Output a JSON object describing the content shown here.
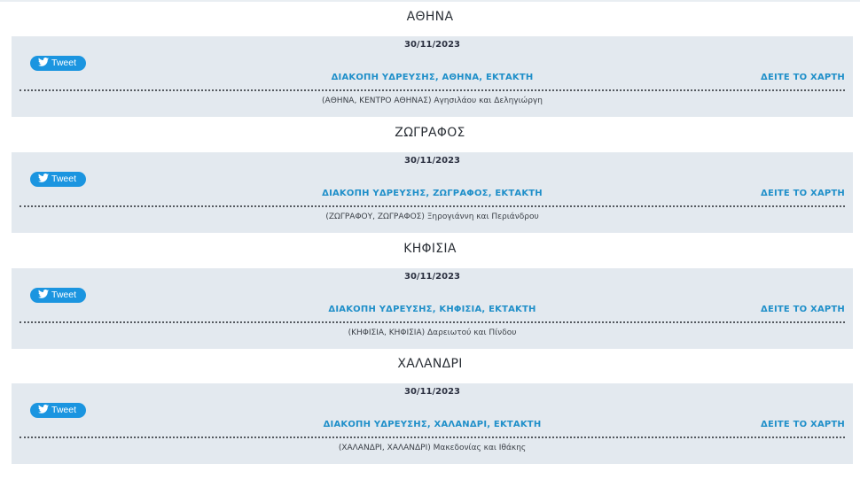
{
  "sections": [
    {
      "area": "ΑΘΗΝΑ",
      "date": "30/11/2023",
      "tweet_label": "Tweet",
      "incident": "ΔΙΑΚΟΠΗ ΥΔΡΕΥΣΗΣ, ΑΘΗΝΑ, ΕΚΤΑΚΤΗ",
      "map_link": "ΔΕΙΤΕ ΤΟ ΧΑΡΤΗ",
      "address": "(ΑΘΗΝΑ, ΚΕΝΤΡΟ ΑΘΗΝΑΣ) Αγησιλάου και Δεληγιώργη"
    },
    {
      "area": "ΖΩΓΡΑΦΟΣ",
      "date": "30/11/2023",
      "tweet_label": "Tweet",
      "incident": "ΔΙΑΚΟΠΗ ΥΔΡΕΥΣΗΣ, ΖΩΓΡΑΦΟΣ, ΕΚΤΑΚΤΗ",
      "map_link": "ΔΕΙΤΕ ΤΟ ΧΑΡΤΗ",
      "address": "(ΖΩΓΡΑΦΟΥ, ΖΩΓΡΑΦΟΣ) Ξηρογιάννη και Περιάνδρου"
    },
    {
      "area": "ΚΗΦΙΣΙΑ",
      "date": "30/11/2023",
      "tweet_label": "Tweet",
      "incident": "ΔΙΑΚΟΠΗ ΥΔΡΕΥΣΗΣ, ΚΗΦΙΣΙΑ, ΕΚΤΑΚΤΗ",
      "map_link": "ΔΕΙΤΕ ΤΟ ΧΑΡΤΗ",
      "address": "(ΚΗΦΙΣΙΑ, ΚΗΦΙΣΙΑ) Δαρειωτού και Πίνδου"
    },
    {
      "area": "ΧΑΛΑΝΔΡΙ",
      "date": "30/11/2023",
      "tweet_label": "Tweet",
      "incident": "ΔΙΑΚΟΠΗ ΥΔΡΕΥΣΗΣ, ΧΑΛΑΝΔΡΙ, ΕΚΤΑΚΤΗ",
      "map_link": "ΔΕΙΤΕ ΤΟ ΧΑΡΤΗ",
      "address": "(ΧΑΛΑΝΔΡΙ, ΧΑΛΑΝΔΡΙ) Μακεδονίας και Ιθάκης"
    }
  ],
  "colors": {
    "card_background": "#e3e9ef",
    "link": "#1f8fc9",
    "tweet_button": "#1b95e0"
  },
  "icons": {
    "tweet": "twitter-bird-icon"
  }
}
